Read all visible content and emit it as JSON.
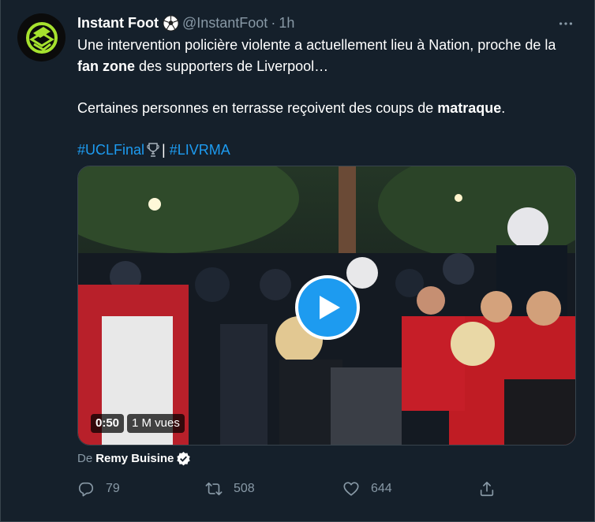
{
  "tweet": {
    "display_name": "Instant Foot",
    "name_emoji_icon": "soccer-ball-icon",
    "handle": "@InstantFoot",
    "separator": "·",
    "time": "1h",
    "more_icon": "more-horizontal-icon",
    "more_label": "•••",
    "text": {
      "p1_a": "Une intervention policière violente a actuellement lieu à Nation, proche de la ",
      "p1_bold": "fan zone",
      "p1_b": " des supporters de Liverpool…",
      "p2_a": "Certaines personnes en terrasse reçoivent des coups de ",
      "p2_bold": "matraque",
      "p2_b": ".",
      "hashtag1": "#UCLFinal",
      "hashtag1_icon": "trophy-icon",
      "divider": "|",
      "hashtag2": "#LIVRMA"
    },
    "media": {
      "type": "video",
      "duration": "0:50",
      "views": "1 M vues",
      "play_icon": "play-icon"
    },
    "attribution": {
      "prefix": "De",
      "author": "Remy Buisine",
      "verified_icon": "verified-badge-icon"
    },
    "actions": {
      "reply_count": "79",
      "retweet_count": "508",
      "like_count": "644",
      "reply_icon": "reply-icon",
      "retweet_icon": "retweet-icon",
      "like_icon": "heart-icon",
      "share_icon": "share-icon"
    }
  },
  "colors": {
    "background": "#15202b",
    "text_primary": "#ffffff",
    "text_secondary": "#8899a6",
    "accent": "#1d9bf0",
    "avatar_logo": "#a6e22e"
  }
}
